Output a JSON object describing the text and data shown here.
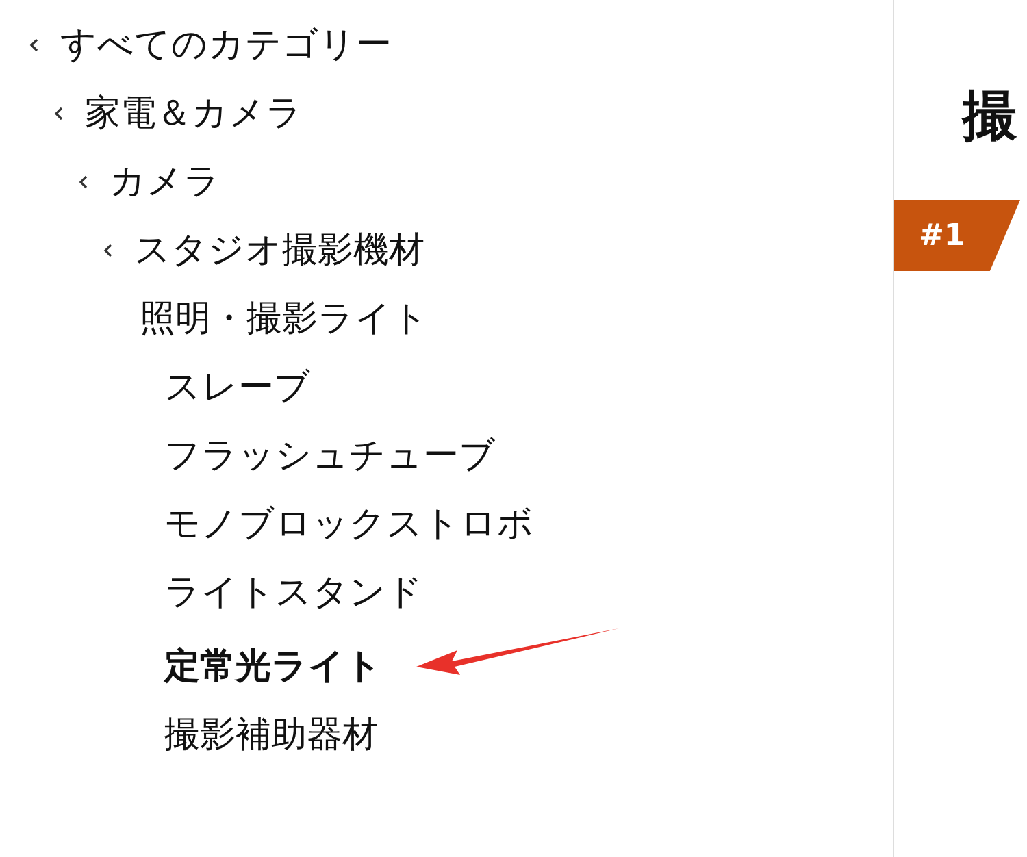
{
  "category_tree": [
    {
      "label": "すべてのカテゴリー",
      "kind": "ancestor",
      "children": [
        {
          "label": "家電＆カメラ",
          "kind": "ancestor",
          "children": [
            {
              "label": "カメラ",
              "kind": "ancestor",
              "children": [
                {
                  "label": "スタジオ撮影機材",
                  "kind": "ancestor",
                  "children": [
                    {
                      "label": "照明・撮影ライト",
                      "kind": "current",
                      "children": [
                        {
                          "label": "スレーブ",
                          "kind": "leaf",
                          "selected": false
                        },
                        {
                          "label": "フラッシュチューブ",
                          "kind": "leaf",
                          "selected": false
                        },
                        {
                          "label": "モノブロックストロボ",
                          "kind": "leaf",
                          "selected": false
                        },
                        {
                          "label": "ライトスタンド",
                          "kind": "leaf",
                          "selected": false
                        },
                        {
                          "label": "定常光ライト",
                          "kind": "leaf",
                          "selected": true
                        },
                        {
                          "label": "撮影補助器材",
                          "kind": "leaf",
                          "selected": false
                        }
                      ]
                    }
                  ]
                }
              ]
            }
          ]
        }
      ]
    }
  ],
  "heading": "撮",
  "rank_badge": "#1"
}
